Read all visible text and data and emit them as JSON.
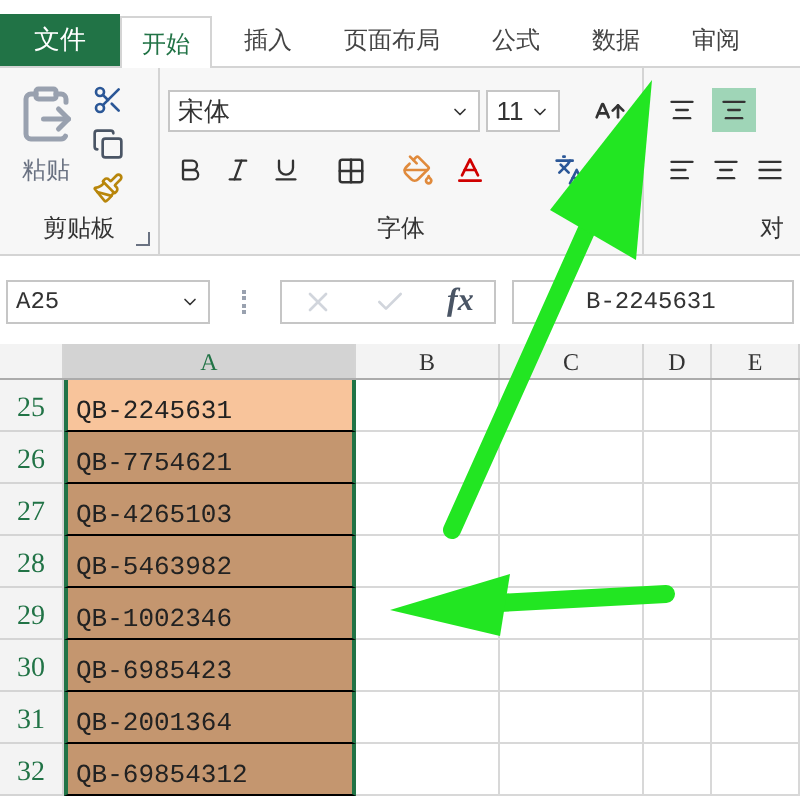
{
  "tabs": [
    {
      "label": "文件",
      "kind": "file",
      "selected": false
    },
    {
      "label": "开始",
      "kind": "tab",
      "selected": true
    },
    {
      "label": "插入",
      "kind": "tab",
      "selected": false
    },
    {
      "label": "页面布局",
      "kind": "tab",
      "selected": false
    },
    {
      "label": "公式",
      "kind": "tab",
      "selected": false
    },
    {
      "label": "数据",
      "kind": "tab",
      "selected": false
    },
    {
      "label": "审阅",
      "kind": "tab",
      "selected": false
    }
  ],
  "clipboard": {
    "paste_label": "粘贴",
    "group_label": "剪贴板"
  },
  "font": {
    "name": "宋体",
    "size": "11",
    "group_label": "字体"
  },
  "alignment": {
    "group_label": "对",
    "buttons": [
      {
        "selected": false
      },
      {
        "selected": true
      }
    ]
  },
  "formula_bar": {
    "name_box": "A25",
    "fx": "fx",
    "value": "B-2245631"
  },
  "columns": [
    {
      "label": "A",
      "selected": true
    },
    {
      "label": "B",
      "selected": false
    },
    {
      "label": "C",
      "selected": false
    },
    {
      "label": "D",
      "selected": false
    },
    {
      "label": "E",
      "selected": false
    }
  ],
  "rows": [
    {
      "header": "25",
      "value": "QB-2245631",
      "active": true
    },
    {
      "header": "26",
      "value": "QB-7754621",
      "active": false
    },
    {
      "header": "27",
      "value": "QB-4265103",
      "active": false
    },
    {
      "header": "28",
      "value": "QB-5463982",
      "active": false
    },
    {
      "header": "29",
      "value": "QB-1002346",
      "active": false
    },
    {
      "header": "30",
      "value": "QB-6985423",
      "active": false
    },
    {
      "header": "31",
      "value": "QB-2001364",
      "active": false
    },
    {
      "header": "32",
      "value": "QB-69854312",
      "active": false
    }
  ]
}
